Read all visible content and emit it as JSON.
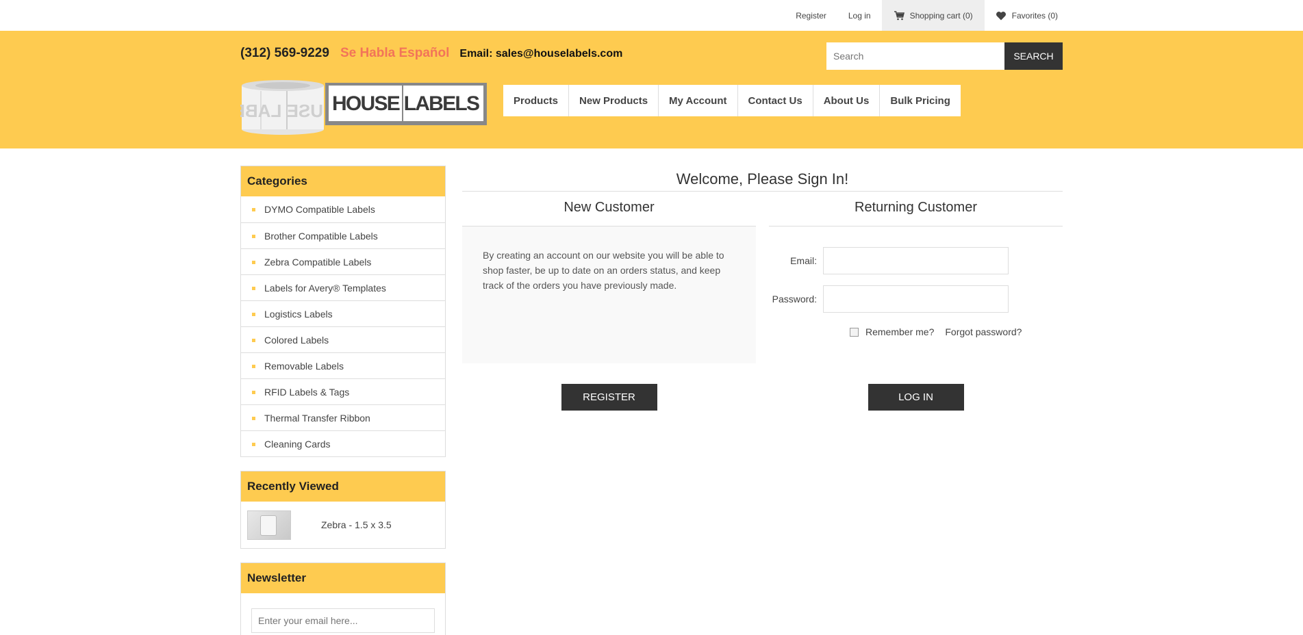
{
  "topbar": {
    "register": "Register",
    "login": "Log in",
    "cart": "Shopping cart (0)",
    "favorites": "Favorites (0)"
  },
  "header": {
    "phone": "(312) 569-9229",
    "habla": "Se Habla Español",
    "email": "Email: sales@houselabels.com",
    "search_placeholder": "Search",
    "search_button": "SEARCH",
    "logo_text": "HOUSE LABELS",
    "logo_roll_text": "USE LABE",
    "accent_color": "#fecb50"
  },
  "nav": {
    "items": [
      "Products",
      "New Products",
      "My Account",
      "Contact Us",
      "About Us",
      "Bulk Pricing"
    ]
  },
  "sidebar": {
    "categories_title": "Categories",
    "categories": [
      "DYMO Compatible Labels",
      "Brother Compatible Labels",
      "Zebra Compatible Labels",
      "Labels for Avery® Templates",
      "Logistics Labels",
      "Colored Labels",
      "Removable Labels",
      "RFID Labels & Tags",
      "Thermal Transfer Ribbon",
      "Cleaning Cards"
    ],
    "recent_title": "Recently Viewed",
    "recent_item": "Zebra - 1.5 x 3.5",
    "newsletter_title": "Newsletter",
    "newsletter_placeholder": "Enter your email here..."
  },
  "main": {
    "title": "Welcome, Please Sign In!",
    "new_customer_title": "New Customer",
    "new_customer_text": "By creating an account on our website you will be able to shop faster, be up to date on an orders status, and keep track of the orders you have previously made.",
    "register_button": "REGISTER",
    "returning_title": "Returning Customer",
    "email_label": "Email:",
    "password_label": "Password:",
    "remember_label": "Remember me?",
    "forgot_label": "Forgot password?",
    "login_button": "LOG IN"
  }
}
